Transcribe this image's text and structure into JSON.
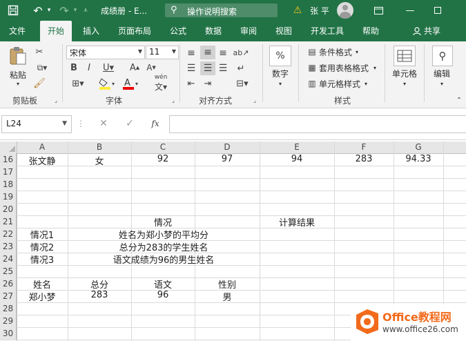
{
  "titlebar": {
    "title": "成绩册 - E...",
    "search_placeholder": "操作说明搜索",
    "user": "张 平",
    "warning": "⚠"
  },
  "tabs": [
    "文件",
    "开始",
    "插入",
    "页面布局",
    "公式",
    "数据",
    "审阅",
    "视图",
    "开发工具",
    "帮助"
  ],
  "share": "共享",
  "ribbon": {
    "paste": "粘贴",
    "clipboard": "剪贴板",
    "font_name": "宋体",
    "font_size": "11",
    "font_group": "字体",
    "align_group": "对齐方式",
    "number_label": "数字",
    "number_symbol": "%",
    "cond_format": "条件格式",
    "table_format": "套用表格格式",
    "cell_style": "单元格样式",
    "styles_group": "样式",
    "cells_label": "单元格",
    "edit_label": "编辑"
  },
  "formula": {
    "name_box": "L24",
    "fx": "fx",
    "content": ""
  },
  "columns": [
    "A",
    "B",
    "C",
    "D",
    "E",
    "F",
    "G"
  ],
  "rows": [
    "16",
    "17",
    "18",
    "19",
    "20",
    "21",
    "22",
    "23",
    "24",
    "25",
    "26",
    "27",
    "28",
    "29",
    "30"
  ],
  "cells": {
    "a16": "张文静",
    "b16": "女",
    "c16": "92",
    "d16": "97",
    "e16": "94",
    "f16": "283",
    "g16": "94.33",
    "c21": "情况",
    "e21": "计算结果",
    "a22": "情况1",
    "bd22": "姓名为郑小梦的平均分",
    "a23": "情况2",
    "bd23": "总分为283的学生姓名",
    "a24": "情况3",
    "bd24": "语文成绩为96的男生姓名",
    "a26": "姓名",
    "b26": "总分",
    "c26": "语文",
    "d26": "性别",
    "a27": "郑小梦",
    "b27": "283",
    "c27": "96",
    "d27": "男"
  },
  "watermark": {
    "brand": "Office教程网",
    "url": "www.office26.com"
  },
  "colors": {
    "accent": "#217346",
    "watermark_orange": "#f26a1b"
  }
}
